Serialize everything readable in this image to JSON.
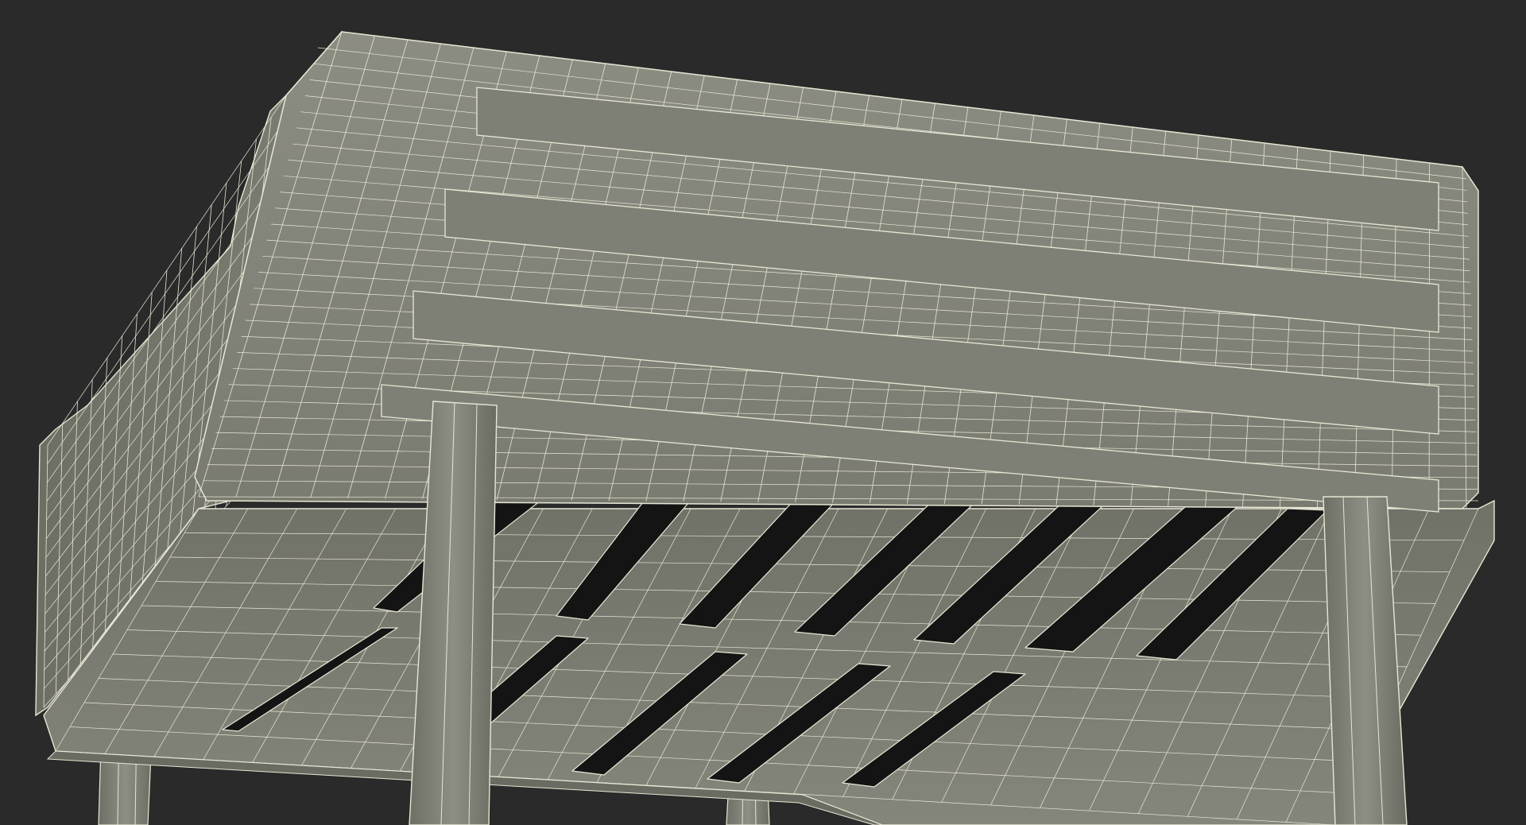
{
  "scene": {
    "subject": "wireframe-render",
    "colors": {
      "background": "#2a2a2a",
      "surface_light": "#8a8b80",
      "surface_mid": "#75766b",
      "surface_dark": "#5f6057",
      "wire": "#e8e6d4",
      "slot": "#121212"
    }
  }
}
